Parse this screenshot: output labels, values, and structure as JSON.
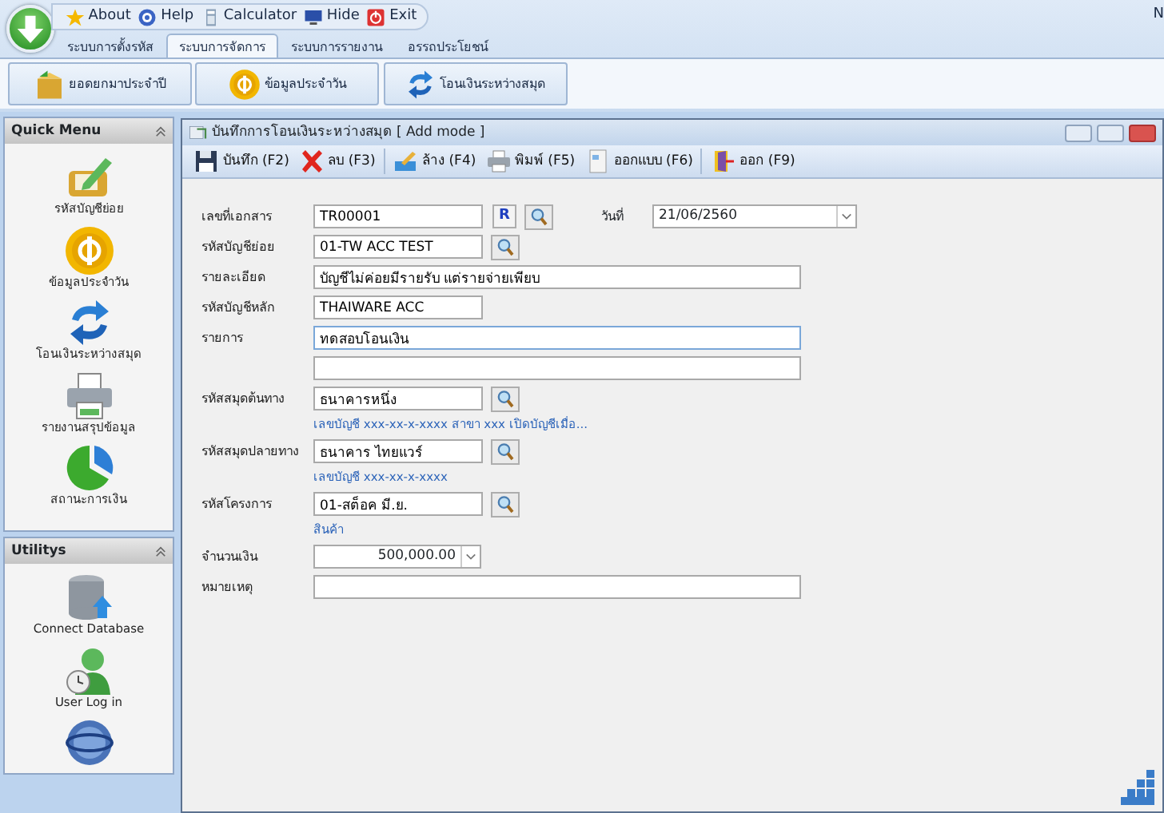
{
  "quick_access": [
    {
      "kind": "star",
      "label": "About"
    },
    {
      "kind": "help",
      "label": "Help"
    },
    {
      "kind": "calc",
      "label": "Calculator"
    },
    {
      "kind": "monitor",
      "label": "Hide"
    },
    {
      "kind": "power",
      "label": "Exit"
    }
  ],
  "corner_text": "N",
  "tabs": [
    {
      "label": "ระบบการตั้งรหัส",
      "selected": false
    },
    {
      "label": "ระบบการจัดการ",
      "selected": true
    },
    {
      "label": "ระบบการรายงาน",
      "selected": false
    },
    {
      "label": "อรรถประโยชน์",
      "selected": false
    }
  ],
  "ribbon_buttons": [
    {
      "kind": "box",
      "label": "ยอดยกมาประจำปี"
    },
    {
      "kind": "coin",
      "label": "ข้อมูลประจำวัน"
    },
    {
      "kind": "arrows",
      "label": "โอนเงินระหว่างสมุด"
    }
  ],
  "sidebar": [
    {
      "title": "Quick Menu",
      "items": [
        {
          "kind": "pencil",
          "label": "รหัสบัญชีย่อย"
        },
        {
          "kind": "coin",
          "label": "ข้อมูลประจำวัน"
        },
        {
          "kind": "arrows",
          "label": "โอนเงินระหว่างสมุด"
        },
        {
          "kind": "printer",
          "label": "รายงานสรุปข้อมูล"
        },
        {
          "kind": "pie",
          "label": "สถานะการเงิน"
        }
      ]
    },
    {
      "title": "Utilitys",
      "items": [
        {
          "kind": "database",
          "label": "Connect Database"
        },
        {
          "kind": "user",
          "label": "User Log in"
        },
        {
          "kind": "globe"
        }
      ]
    }
  ],
  "window": {
    "title": "บันทึกการโอนเงินระหว่างสมุด [ Add mode ]",
    "toolbar": [
      {
        "kind": "save",
        "label": "บันทึก (F2)"
      },
      {
        "kind": "delete",
        "label": "ลบ (F3)"
      },
      {
        "kind": "clear",
        "label": "ล้าง (F4)"
      },
      {
        "kind": "print",
        "label": "พิมพ์ (F5)"
      },
      {
        "kind": "design",
        "label": "ออกแบบ (F6)"
      },
      {
        "kind": "exit",
        "label": "ออก (F9)"
      }
    ],
    "form": [
      [
        {
          "kind": "label",
          "text": "เลขที่เอกสาร"
        },
        {
          "kind": "field",
          "value": "TR00001"
        },
        {
          "kind": "rbutton",
          "text": "R"
        },
        {
          "kind": "lookup"
        },
        {
          "kind": "label2",
          "text": "วันที่"
        },
        {
          "kind": "datecombo",
          "value": "21/06/2560"
        }
      ],
      [
        {
          "kind": "label",
          "text": "รหัสบัญชีย่อย"
        },
        {
          "kind": "field",
          "value": "01-TW ACC TEST"
        },
        {
          "kind": "lookup"
        }
      ],
      [
        {
          "kind": "label",
          "text": "รายละเอียด"
        },
        {
          "kind": "widefield",
          "value": "บัญชีไม่ค่อยมีรายรับ แต่รายจ่ายเพียบ"
        }
      ],
      [
        {
          "kind": "label",
          "text": "รหัสบัญชีหลัก"
        },
        {
          "kind": "field",
          "value": "THAIWARE ACC"
        }
      ],
      [
        {
          "kind": "label",
          "text": "รายการ"
        },
        {
          "kind": "widefield",
          "value": "ทดสอบโอนเงิน",
          "focused": true
        }
      ],
      [
        {
          "kind": "label"
        },
        {
          "kind": "widefield",
          "focused": false
        }
      ],
      [
        {
          "kind": "label",
          "text": "รหัสสมุดต้นทาง"
        },
        {
          "kind": "field",
          "value": "ธนาคารหนึ่ง"
        },
        {
          "kind": "lookup"
        }
      ],
      [
        {
          "kind": "label"
        },
        {
          "kind": "note",
          "text": "เลขบัญชี xxx-xx-x-xxxx สาขา xxx เปิดบัญชีเมื่อ..."
        }
      ],
      [
        {
          "kind": "label",
          "text": "รหัสสมุดปลายทาง"
        },
        {
          "kind": "field",
          "value": "ธนาคาร ไทยแวร์"
        },
        {
          "kind": "lookup"
        }
      ],
      [
        {
          "kind": "label"
        },
        {
          "kind": "note",
          "text": "เลขบัญชี xxx-xx-x-xxxx"
        }
      ],
      [
        {
          "kind": "label",
          "text": "รหัสโครงการ"
        },
        {
          "kind": "field",
          "value": "01-สต็อค มี.ย."
        },
        {
          "kind": "lookup"
        }
      ],
      [
        {
          "kind": "label"
        },
        {
          "kind": "note",
          "text": "สินค้า"
        }
      ],
      [
        {
          "kind": "label",
          "text": "จำนวนเงิน"
        },
        {
          "kind": "moneycombo",
          "value": "500,000.00"
        }
      ],
      [
        {
          "kind": "label",
          "text": "หมายเหตุ"
        },
        {
          "kind": "widefield",
          "focused": false
        }
      ]
    ]
  }
}
